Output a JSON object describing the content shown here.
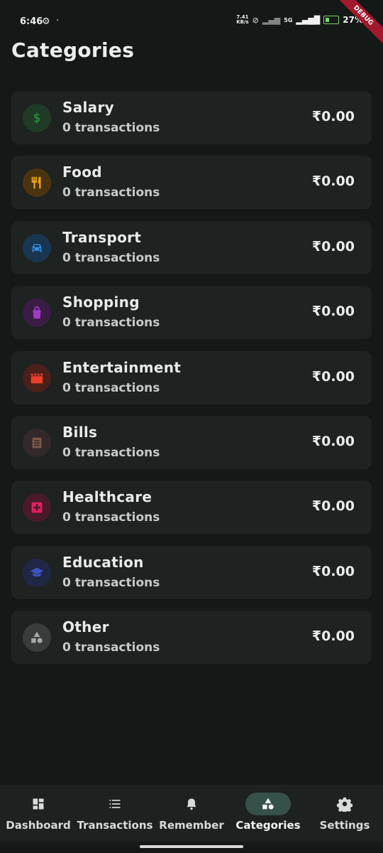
{
  "status_bar": {
    "time": "6:46",
    "net_speed_value": "7.41",
    "net_speed_unit": "KB/s",
    "network": "5G",
    "battery": "27%",
    "debug_label": "DEBUG"
  },
  "page": {
    "title": "Categories"
  },
  "categories": [
    {
      "name": "Salary",
      "count": "0 transactions",
      "amount": "₹0.00",
      "icon": "dollar-icon",
      "color": "#2e8b3e",
      "bg": "#1f3a27"
    },
    {
      "name": "Food",
      "count": "0 transactions",
      "amount": "₹0.00",
      "icon": "fork-knife-icon",
      "color": "#f0a020",
      "bg": "#4a3410"
    },
    {
      "name": "Transport",
      "count": "0 transactions",
      "amount": "₹0.00",
      "icon": "car-icon",
      "color": "#2f8fe6",
      "bg": "#1a3550"
    },
    {
      "name": "Shopping",
      "count": "0 transactions",
      "amount": "₹0.00",
      "icon": "shopping-bag-icon",
      "color": "#a13bc9",
      "bg": "#3a1d45"
    },
    {
      "name": "Entertainment",
      "count": "0 transactions",
      "amount": "₹0.00",
      "icon": "clapperboard-icon",
      "color": "#e8402b",
      "bg": "#4b1f1a"
    },
    {
      "name": "Bills",
      "count": "0 transactions",
      "amount": "₹0.00",
      "icon": "receipt-icon",
      "color": "#7a5546",
      "bg": "#33292a"
    },
    {
      "name": "Healthcare",
      "count": "0 transactions",
      "amount": "₹0.00",
      "icon": "medical-icon",
      "color": "#e0205f",
      "bg": "#4a1a2b"
    },
    {
      "name": "Education",
      "count": "0 transactions",
      "amount": "₹0.00",
      "icon": "graduation-cap-icon",
      "color": "#3d55c2",
      "bg": "#1f2745"
    },
    {
      "name": "Other",
      "count": "0 transactions",
      "amount": "₹0.00",
      "icon": "shapes-icon",
      "color": "#a7a9a8",
      "bg": "#3a3c3c"
    }
  ],
  "bottom_nav": {
    "items": [
      {
        "label": "Dashboard",
        "icon": "dashboard-icon"
      },
      {
        "label": "Transactions",
        "icon": "list-icon"
      },
      {
        "label": "Remember",
        "icon": "bell-icon"
      },
      {
        "label": "Categories",
        "icon": "shapes-icon",
        "active": true
      },
      {
        "label": "Settings",
        "icon": "gear-icon"
      }
    ]
  }
}
